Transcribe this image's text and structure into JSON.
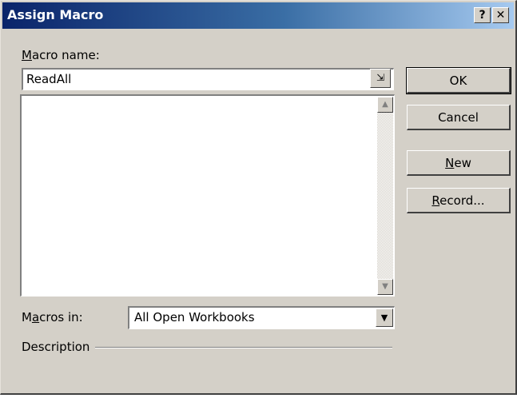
{
  "window": {
    "title": "Assign Macro",
    "help_symbol": "?",
    "close_symbol": "✕"
  },
  "macro_name": {
    "label_underlined": "M",
    "label_rest": "acro name:",
    "value": "ReadAll",
    "collapse_glyph": "⇲"
  },
  "macro_list": {
    "items": [],
    "scroll_up_glyph": "▲",
    "scroll_down_glyph": "▼"
  },
  "buttons": {
    "ok": "OK",
    "cancel": "Cancel",
    "new_underlined": "N",
    "new_rest": "ew",
    "record_underlined": "R",
    "record_rest": "ecord..."
  },
  "macros_in": {
    "label_pre": "M",
    "label_underlined": "a",
    "label_rest": "cros in:",
    "selected": "All Open Workbooks",
    "arrow_glyph": "▼"
  },
  "description": {
    "label": "Description"
  },
  "colors": {
    "dialog_face": "#d4d0c8",
    "title_start": "#0a246a",
    "title_end": "#a6caf0"
  },
  "icons": {
    "collapse": "collapse-dialog-icon",
    "dropdown": "chevron-down-icon"
  }
}
